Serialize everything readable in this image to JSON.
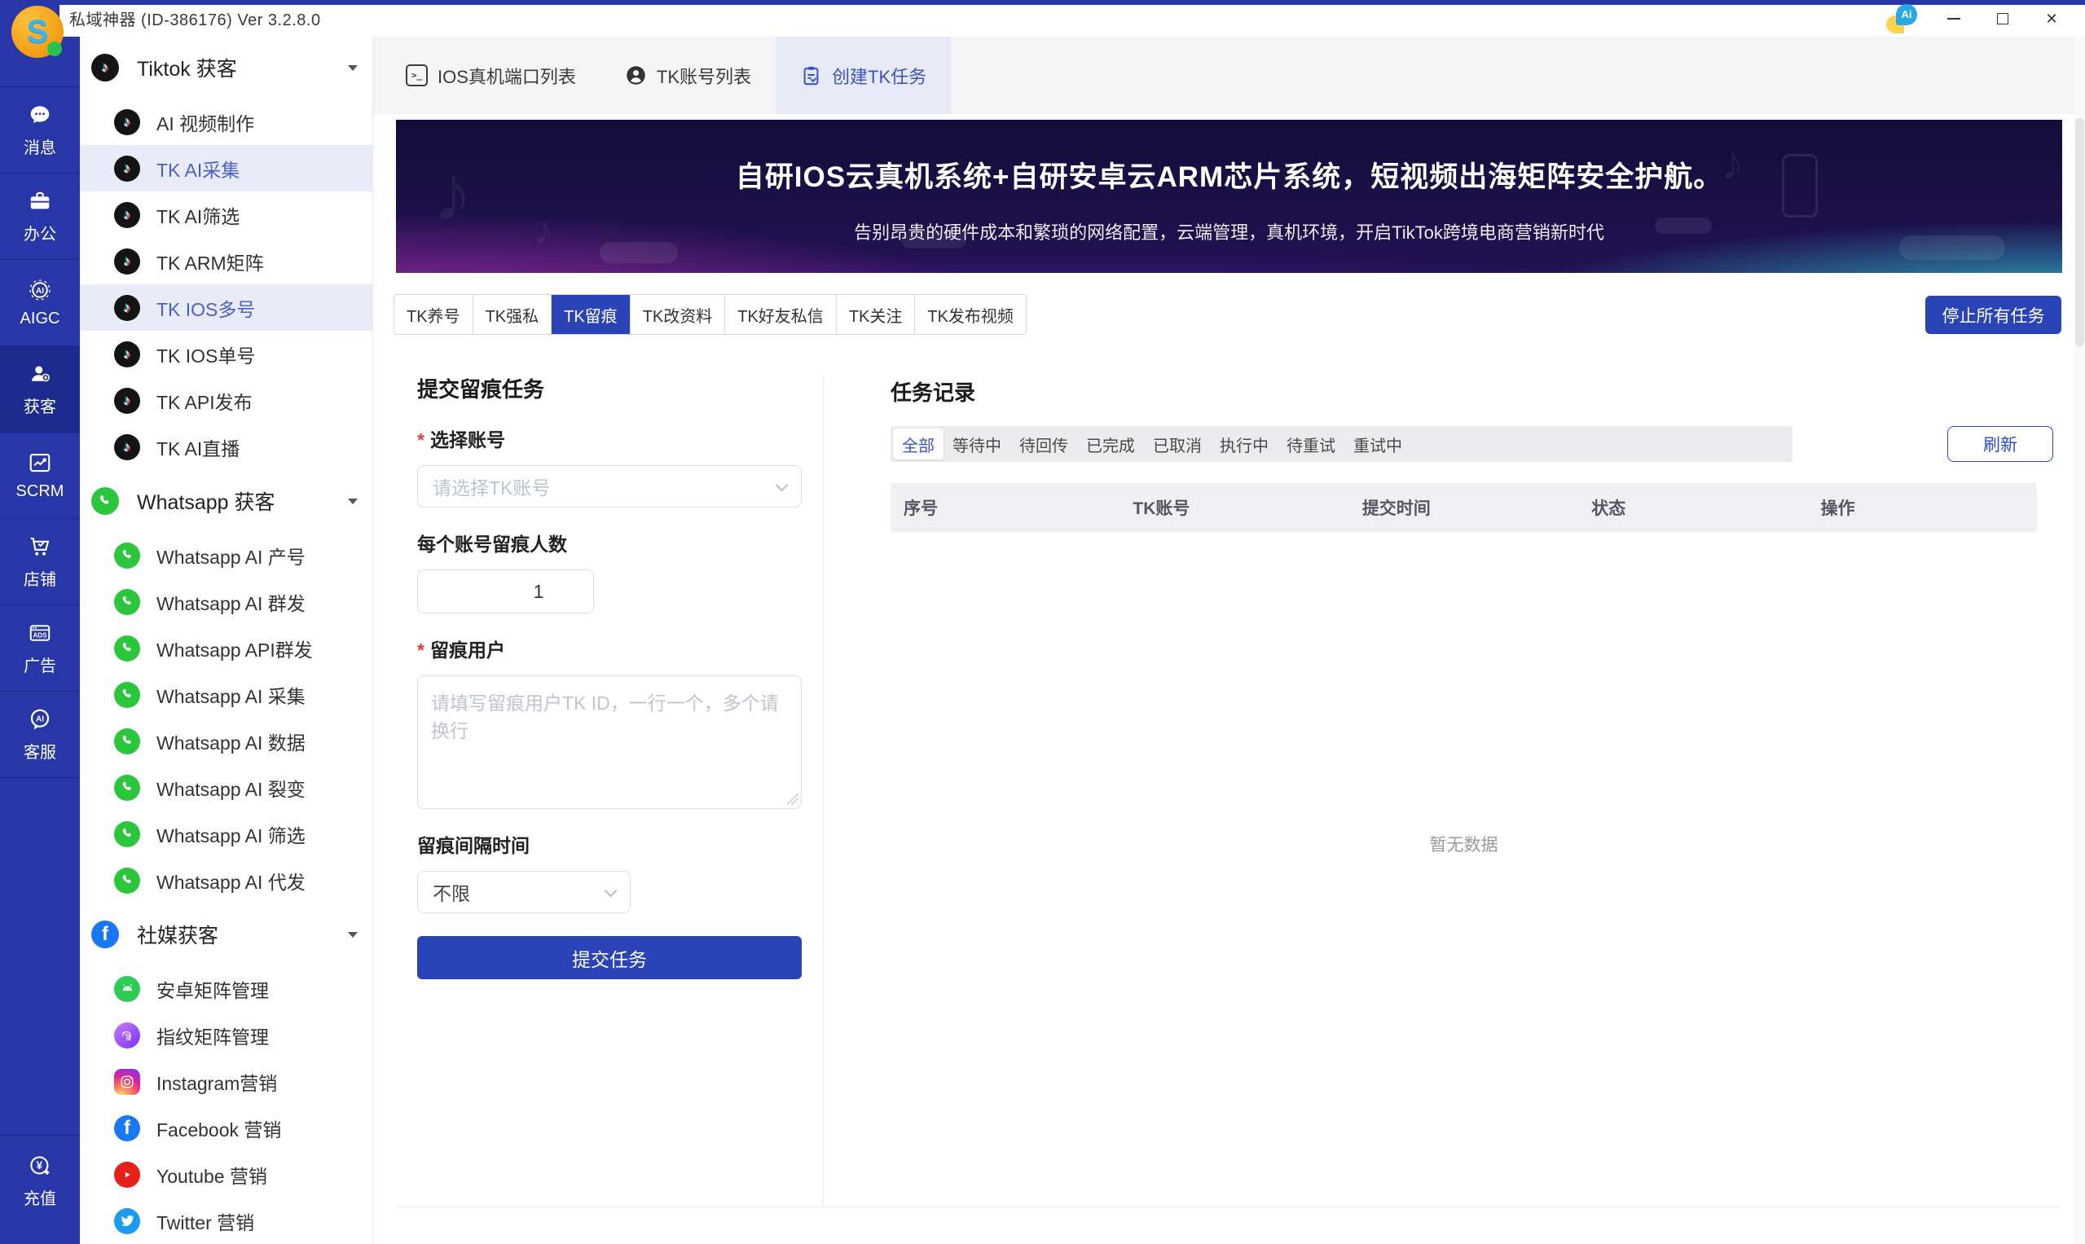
{
  "window": {
    "title": "私域神器 (ID-386176)  Ver 3.2.8.0",
    "controls": [
      "ai-assistant-icon",
      "minimize-icon",
      "maximize-icon",
      "close-icon"
    ]
  },
  "rail": {
    "items": [
      {
        "label": "消息",
        "icon": "message-icon",
        "active": false
      },
      {
        "label": "办公",
        "icon": "briefcase-icon",
        "active": false
      },
      {
        "label": "AIGC",
        "icon": "aigc-icon",
        "active": false
      },
      {
        "label": "获客",
        "icon": "acquire-customer-icon",
        "active": true
      },
      {
        "label": "SCRM",
        "icon": "chart-icon",
        "active": false
      },
      {
        "label": "店铺",
        "icon": "shop-cart-icon",
        "active": false
      },
      {
        "label": "广告",
        "icon": "ads-icon",
        "active": false
      },
      {
        "label": "客服",
        "icon": "ai-service-icon",
        "active": false
      }
    ],
    "bottom_item": {
      "label": "充值",
      "icon": "recharge-icon"
    }
  },
  "sidebar": {
    "groups": [
      {
        "label": "Tiktok 获客",
        "icon": "tiktok-icon",
        "items": [
          {
            "label": "AI 视频制作",
            "icon": "tiktok-icon",
            "highlighted": false
          },
          {
            "label": "TK AI采集",
            "icon": "tiktok-icon",
            "highlighted": true
          },
          {
            "label": "TK AI筛选",
            "icon": "tiktok-icon",
            "highlighted": false
          },
          {
            "label": "TK ARM矩阵",
            "icon": "tiktok-icon",
            "highlighted": false
          },
          {
            "label": "TK IOS多号",
            "icon": "tiktok-icon",
            "highlighted": true
          },
          {
            "label": "TK IOS单号",
            "icon": "tiktok-icon",
            "highlighted": false
          },
          {
            "label": "TK API发布",
            "icon": "tiktok-icon",
            "highlighted": false
          },
          {
            "label": "TK AI直播",
            "icon": "tiktok-icon",
            "highlighted": false
          }
        ]
      },
      {
        "label": "Whatsapp 获客",
        "icon": "whatsapp-icon",
        "items": [
          {
            "label": "Whatsapp AI 产号",
            "icon": "whatsapp-icon",
            "highlighted": false
          },
          {
            "label": "Whatsapp AI 群发",
            "icon": "whatsapp-icon",
            "highlighted": false
          },
          {
            "label": "Whatsapp API群发",
            "icon": "whatsapp-icon",
            "highlighted": false
          },
          {
            "label": "Whatsapp AI 采集",
            "icon": "whatsapp-icon",
            "highlighted": false
          },
          {
            "label": "Whatsapp AI 数据",
            "icon": "whatsapp-icon",
            "highlighted": false
          },
          {
            "label": "Whatsapp AI 裂变",
            "icon": "whatsapp-icon",
            "highlighted": false
          },
          {
            "label": "Whatsapp AI 筛选",
            "icon": "whatsapp-icon",
            "highlighted": false
          },
          {
            "label": "Whatsapp AI 代发",
            "icon": "whatsapp-icon",
            "highlighted": false
          }
        ]
      },
      {
        "label": "社媒获客",
        "icon": "facebook-icon",
        "items": [
          {
            "label": "安卓矩阵管理",
            "icon": "android-icon",
            "highlighted": false
          },
          {
            "label": "指纹矩阵管理",
            "icon": "fingerprint-icon",
            "highlighted": false
          },
          {
            "label": "Instagram营销",
            "icon": "instagram-icon",
            "highlighted": false
          },
          {
            "label": "Facebook 营销",
            "icon": "facebook-icon",
            "highlighted": false
          },
          {
            "label": "Youtube 营销",
            "icon": "youtube-icon",
            "highlighted": false
          },
          {
            "label": "Twitter 营销",
            "icon": "twitter-icon",
            "highlighted": false
          }
        ]
      }
    ]
  },
  "tabs": [
    {
      "label": "IOS真机端口列表",
      "icon": "terminal-icon",
      "active": false
    },
    {
      "label": "TK账号列表",
      "icon": "user-icon",
      "active": false
    },
    {
      "label": "创建TK任务",
      "icon": "clipboard-icon",
      "active": true
    }
  ],
  "banner": {
    "title": "自研IOS云真机系统+自研安卓云ARM芯片系统，短视频出海矩阵安全护航。",
    "subtitle": "告别昂贵的硬件成本和繁琐的网络配置，云端管理，真机环境，开启TikTok跨境电商营销新时代"
  },
  "subtabs": [
    {
      "label": "TK养号",
      "active": false
    },
    {
      "label": "TK强私",
      "active": false
    },
    {
      "label": "TK留痕",
      "active": true
    },
    {
      "label": "TK改资料",
      "active": false
    },
    {
      "label": "TK好友私信",
      "active": false
    },
    {
      "label": "TK关注",
      "active": false
    },
    {
      "label": "TK发布视频",
      "active": false
    }
  ],
  "stop_all_button": "停止所有任务",
  "form": {
    "title": "提交留痕任务",
    "required_mark": "*",
    "account": {
      "label": "选择账号",
      "required": true,
      "placeholder": "请选择TK账号"
    },
    "count": {
      "label": "每个账号留痕人数",
      "value": "1"
    },
    "users": {
      "label": "留痕用户",
      "required": true,
      "placeholder": "请填写留痕用户TK ID，一行一个，多个请换行"
    },
    "interval": {
      "label": "留痕间隔时间",
      "value": "不限"
    },
    "submit_label": "提交任务"
  },
  "tasks": {
    "title": "任务记录",
    "filters": [
      {
        "label": "全部",
        "active": true
      },
      {
        "label": "等待中",
        "active": false
      },
      {
        "label": "待回传",
        "active": false
      },
      {
        "label": "已完成",
        "active": false
      },
      {
        "label": "已取消",
        "active": false
      },
      {
        "label": "执行中",
        "active": false
      },
      {
        "label": "待重试",
        "active": false
      },
      {
        "label": "重试中",
        "active": false
      }
    ],
    "refresh_label": "刷新",
    "columns": [
      "序号",
      "TK账号",
      "提交时间",
      "状态",
      "操作"
    ],
    "empty_text": "暂无数据"
  },
  "colors": {
    "rail_blue": "#2737a8",
    "accent_blue": "#2a44b7",
    "link_blue": "#3b55c6",
    "highlight_bg": "#e9ecf8"
  }
}
